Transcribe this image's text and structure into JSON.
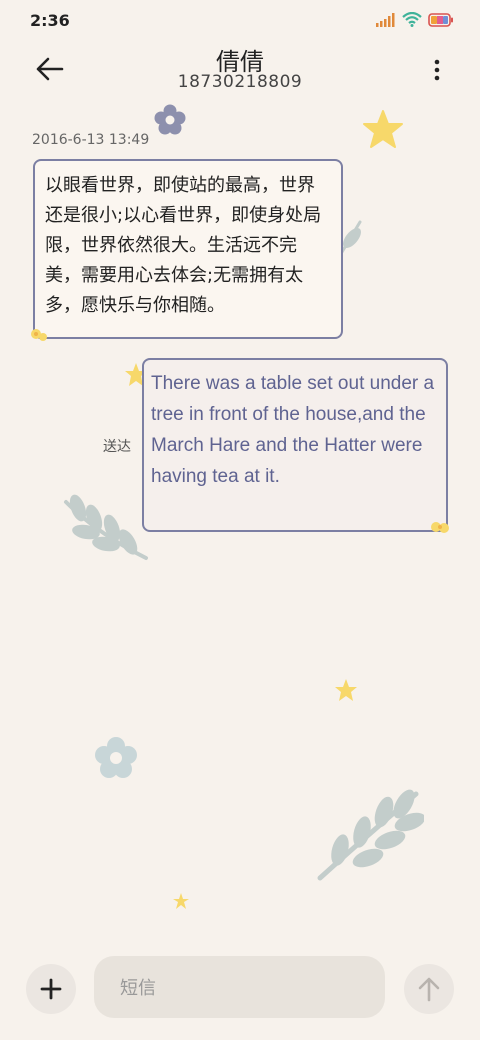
{
  "status_bar": {
    "time": "2:36"
  },
  "header": {
    "contact_name": "倩倩",
    "phone_number": "18730218809"
  },
  "conversation": {
    "timestamp": "2016-6-13 13:49",
    "incoming_message": "以眼看世界，即使站的最高，世界还是很小;以心看世界，即使身处局限，世界依然很大。生活远不完美，需要用心去体会;无需拥有太多，愿快乐与你相随。",
    "outgoing_message": "There was a table set out under a tree in front of the house,and the March Hare and the Hatter were having tea at it.",
    "delivery_status": "送达"
  },
  "composer": {
    "placeholder": "短信"
  },
  "colors": {
    "background": "#f7f2ec",
    "bubble_border": "#7c7fa3",
    "outgoing_text": "#5f6391"
  }
}
